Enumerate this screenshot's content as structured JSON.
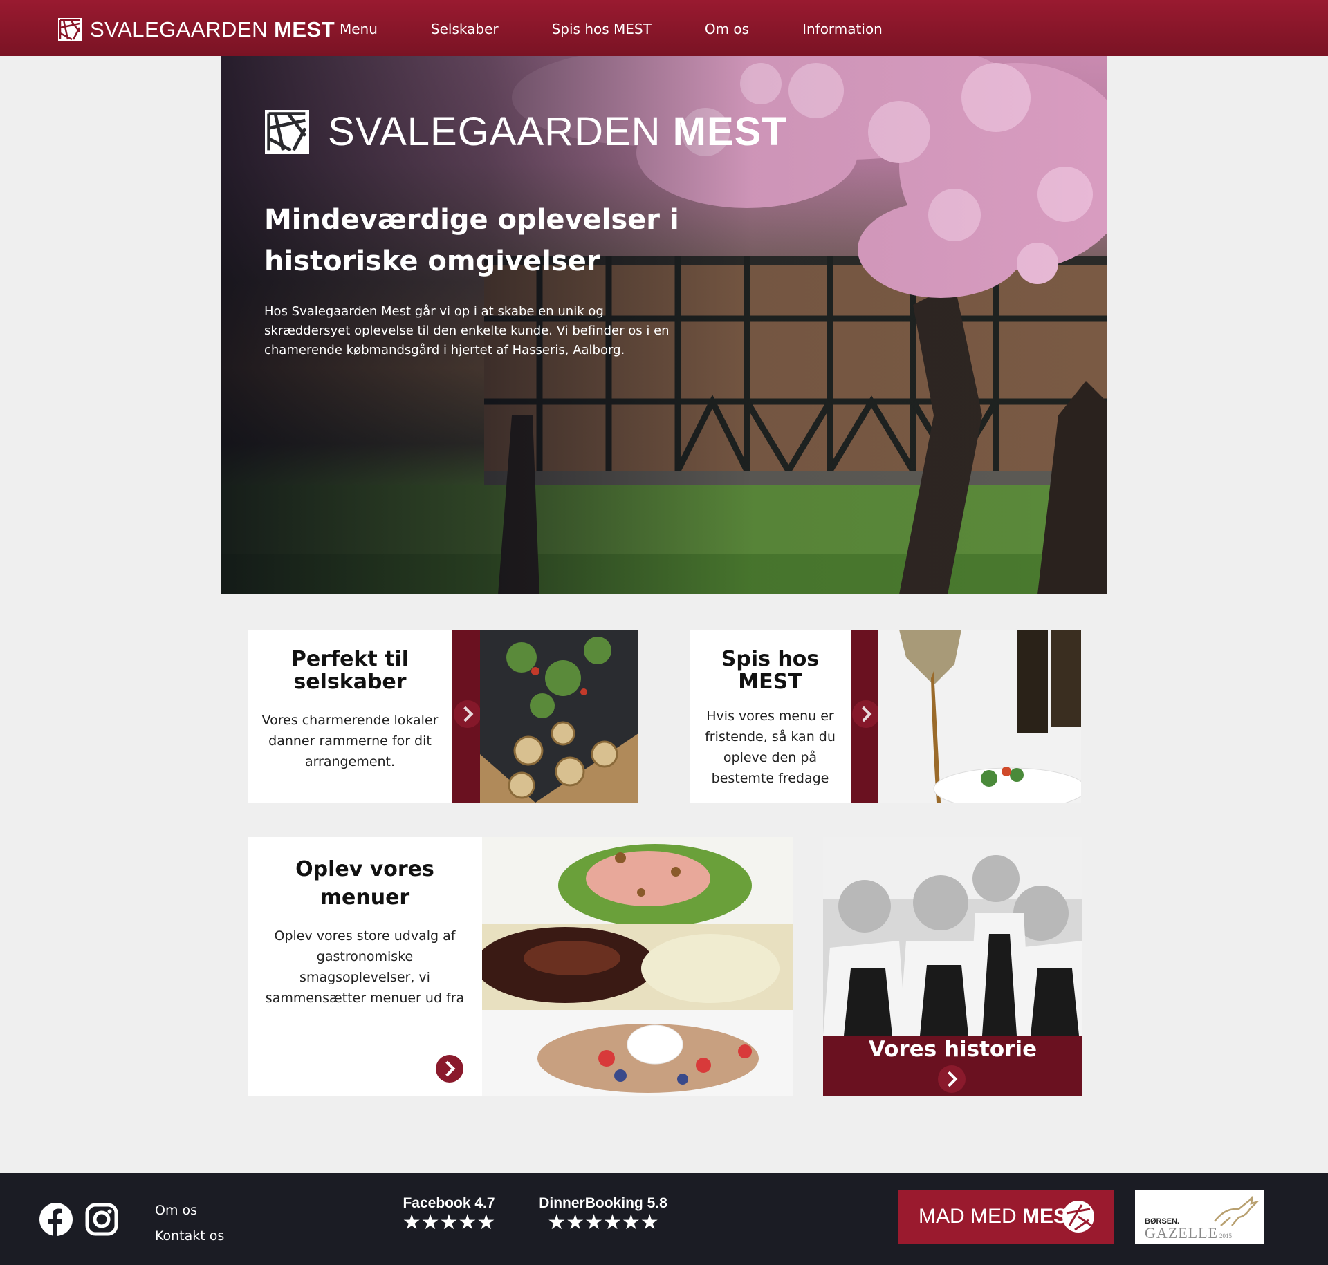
{
  "brand": {
    "name_light": "SVALEGAARDEN",
    "name_bold": "MEST"
  },
  "nav": [
    "Menu",
    "Selskaber",
    "Spis hos MEST",
    "Om os",
    "Information"
  ],
  "hero": {
    "logo_light": "SVALEGAARDEN",
    "logo_bold": "MEST",
    "title": "Mindeværdige oplevelser i historiske omgivelser",
    "text": "Hos Svalegaarden Mest går vi op i at skabe en unik og skræddersyet oplevelse til den enkelte kunde. Vi befinder os i en chamerende købmandsgård i hjertet af Hasseris, Aalborg."
  },
  "cards": {
    "selskaber": {
      "title": "Perfekt til selskaber",
      "text": "Vores charmerende lokaler danner rammerne for dit arrangement."
    },
    "spis": {
      "title": "Spis hos MEST",
      "text": "Hvis vores menu er fristende, så kan du opleve den på bestemte fredage"
    },
    "menuer": {
      "title": "Oplev vores menuer",
      "text": "Oplev vores store udvalg af gastronomiske smagsoplevelser, vi sammensætter menuer ud fra"
    },
    "historie": {
      "title": "Vores historie"
    }
  },
  "footer": {
    "links": [
      "Om os",
      "Kontakt os"
    ],
    "ratings": [
      {
        "label": "Facebook 4.7",
        "stars": "★★★★★"
      },
      {
        "label": "DinnerBooking 5.8",
        "stars": "★★★★★★"
      }
    ],
    "madmest_light": "MAD MED",
    "madmest_bold": "MEST",
    "gazelle_top": "BØRSEN.",
    "gazelle_main": "GAZELLE",
    "gazelle_year": "2015"
  },
  "icons": [
    "logo-mark-icon",
    "facebook-icon",
    "instagram-icon",
    "chevron-right-icon",
    "star-icon",
    "gazelle-icon"
  ],
  "colors": {
    "brand_red": "#991a30",
    "dark_red": "#6a1120",
    "footer_bg": "#1b1c24",
    "page_bg": "#efefef"
  }
}
